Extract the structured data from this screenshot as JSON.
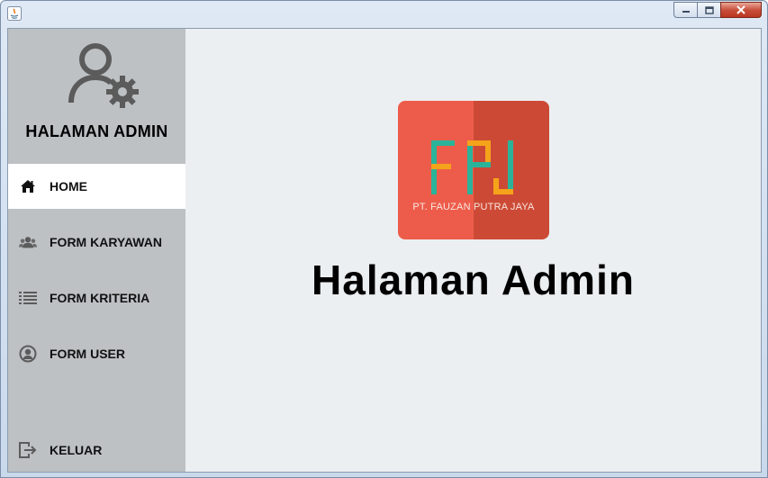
{
  "window": {
    "title": ""
  },
  "sidebar": {
    "title": "HALAMAN ADMIN",
    "items": [
      {
        "label": "HOME",
        "icon": "home-icon",
        "active": true
      },
      {
        "label": "FORM KARYAWAN",
        "icon": "users-group-icon",
        "active": false
      },
      {
        "label": "FORM KRITERIA",
        "icon": "list-icon",
        "active": false
      },
      {
        "label": "FORM USER",
        "icon": "user-circle-icon",
        "active": false
      }
    ],
    "logout": {
      "label": "KELUAR",
      "icon": "logout-icon"
    }
  },
  "main": {
    "logo": {
      "letters": "FPJ",
      "company": "PT. FAUZAN PUTRA JAYA"
    },
    "heading": "Halaman Admin"
  },
  "colors": {
    "sidebar_bg": "#bdc1c4",
    "main_bg": "#eceff1",
    "active_item_bg": "#ffffff",
    "logo_left": "#ed5c4a",
    "logo_right": "#cc4a35",
    "logo_teal": "#2bb39a",
    "logo_orange": "#f5a31a"
  }
}
